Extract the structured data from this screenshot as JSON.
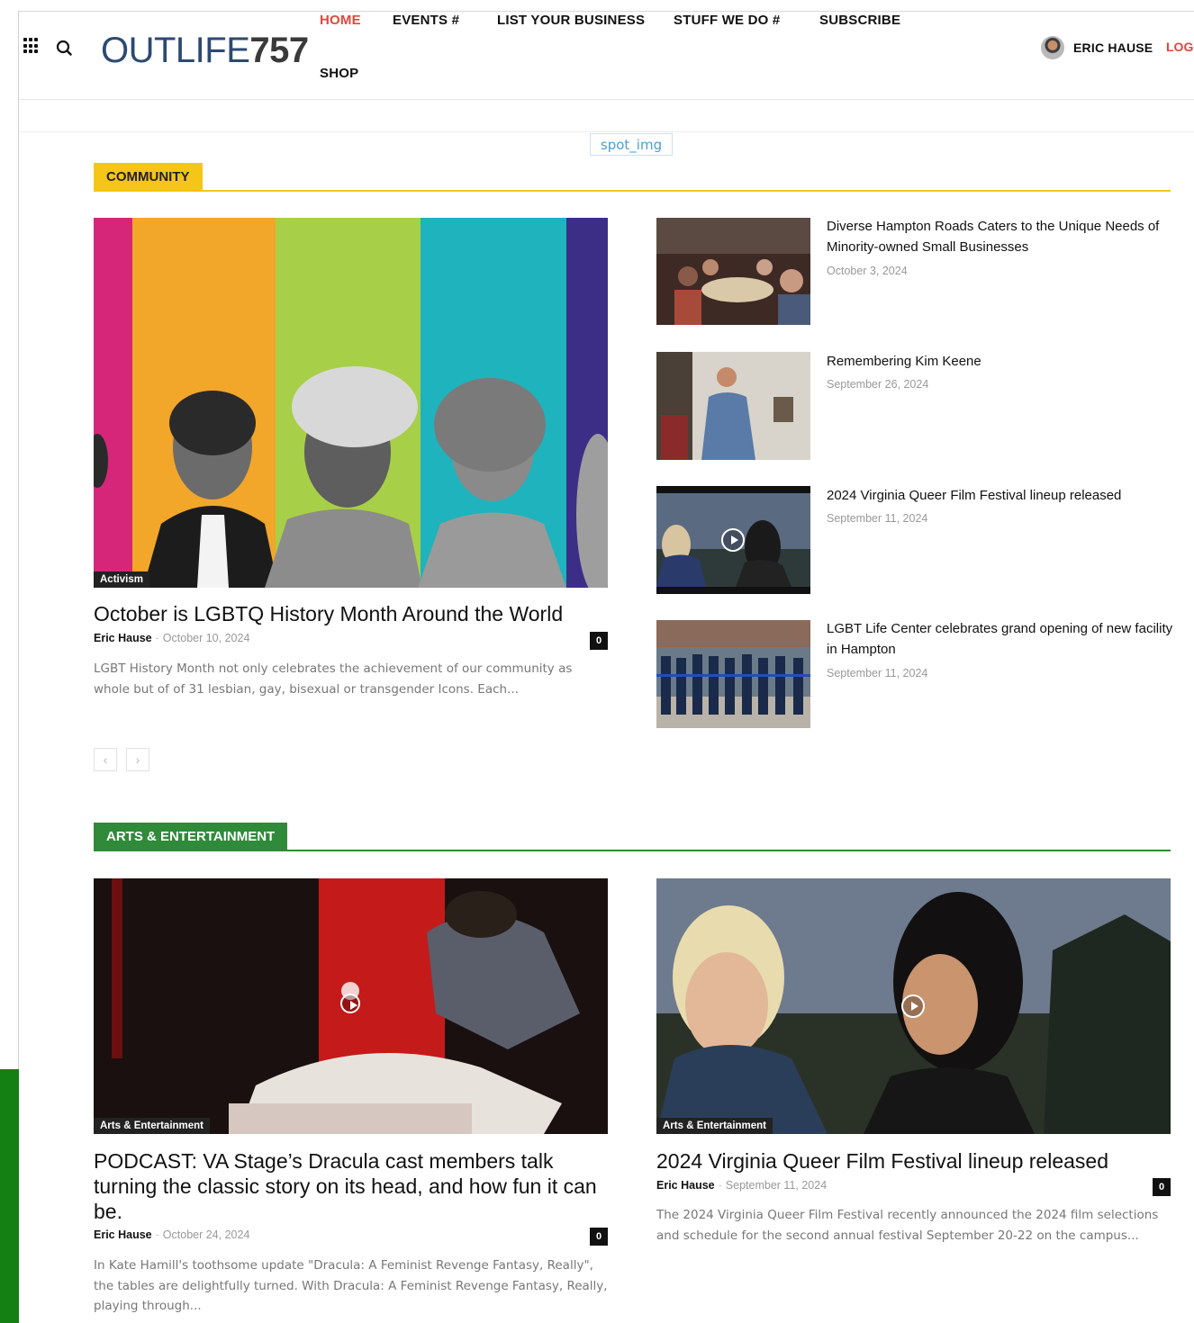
{
  "header": {
    "logo_part1": "OUTLIFE",
    "logo_part2": "757",
    "nav": [
      "HOME",
      "EVENTS #",
      "LIST YOUR BUSINESS",
      "STUFF WE DO #",
      "SUBSCRIBE",
      "SHOP"
    ],
    "active_nav": "HOME",
    "user_name": "ERIC HAUSE",
    "logout_label": "LOGO",
    "accent_color": "#e0483a"
  },
  "ad_placeholder": "spot_img",
  "community": {
    "section_label": "COMMUNITY",
    "section_color": "#f5c518",
    "featured": {
      "category": "Activism",
      "title": "October is LGBTQ History Month Around the World",
      "author": "Eric Hause",
      "date": "October 10, 2024",
      "comments": "0",
      "excerpt": "LGBT History Month not only celebrates the achievement of our community as whole but of of 31 lesbian, gay, bisexual or transgender Icons. Each..."
    },
    "side_posts": [
      {
        "title": "Diverse Hampton Roads Caters to the Unique Needs of Minority-owned Small Businesses",
        "date": "October 3, 2024"
      },
      {
        "title": "Remembering Kim Keene",
        "date": "September 26, 2024"
      },
      {
        "title": "2024 Virginia Queer Film Festival lineup released",
        "date": "September 11, 2024"
      },
      {
        "title": "LGBT Life Center celebrates grand opening of new facility in Hampton",
        "date": "September 11, 2024"
      }
    ],
    "pager_prev": "‹",
    "pager_next": "›"
  },
  "arts": {
    "section_label": "ARTS & ENTERTAINMENT",
    "section_color": "#2f8a3a",
    "posts": [
      {
        "category": "Arts & Entertainment",
        "title": "PODCAST: VA Stage’s Dracula cast members talk turning the classic story on its head, and how fun it can be.",
        "author": "Eric Hause",
        "date": "October 24, 2024",
        "comments": "0",
        "excerpt": "In Kate Hamill's toothsome update \"Dracula: A Feminist Revenge Fantasy, Really\", the tables are delightfully turned. With Dracula: A Feminist Revenge Fantasy, Really, playing through..."
      },
      {
        "category": "Arts & Entertainment",
        "title": "2024 Virginia Queer Film Festival lineup released",
        "author": "Eric Hause",
        "date": "September 11, 2024",
        "comments": "0",
        "excerpt": "The 2024 Virginia Queer Film Festival recently announced the 2024 film selections and schedule for the second annual festival September 20-22 on the campus..."
      }
    ]
  }
}
